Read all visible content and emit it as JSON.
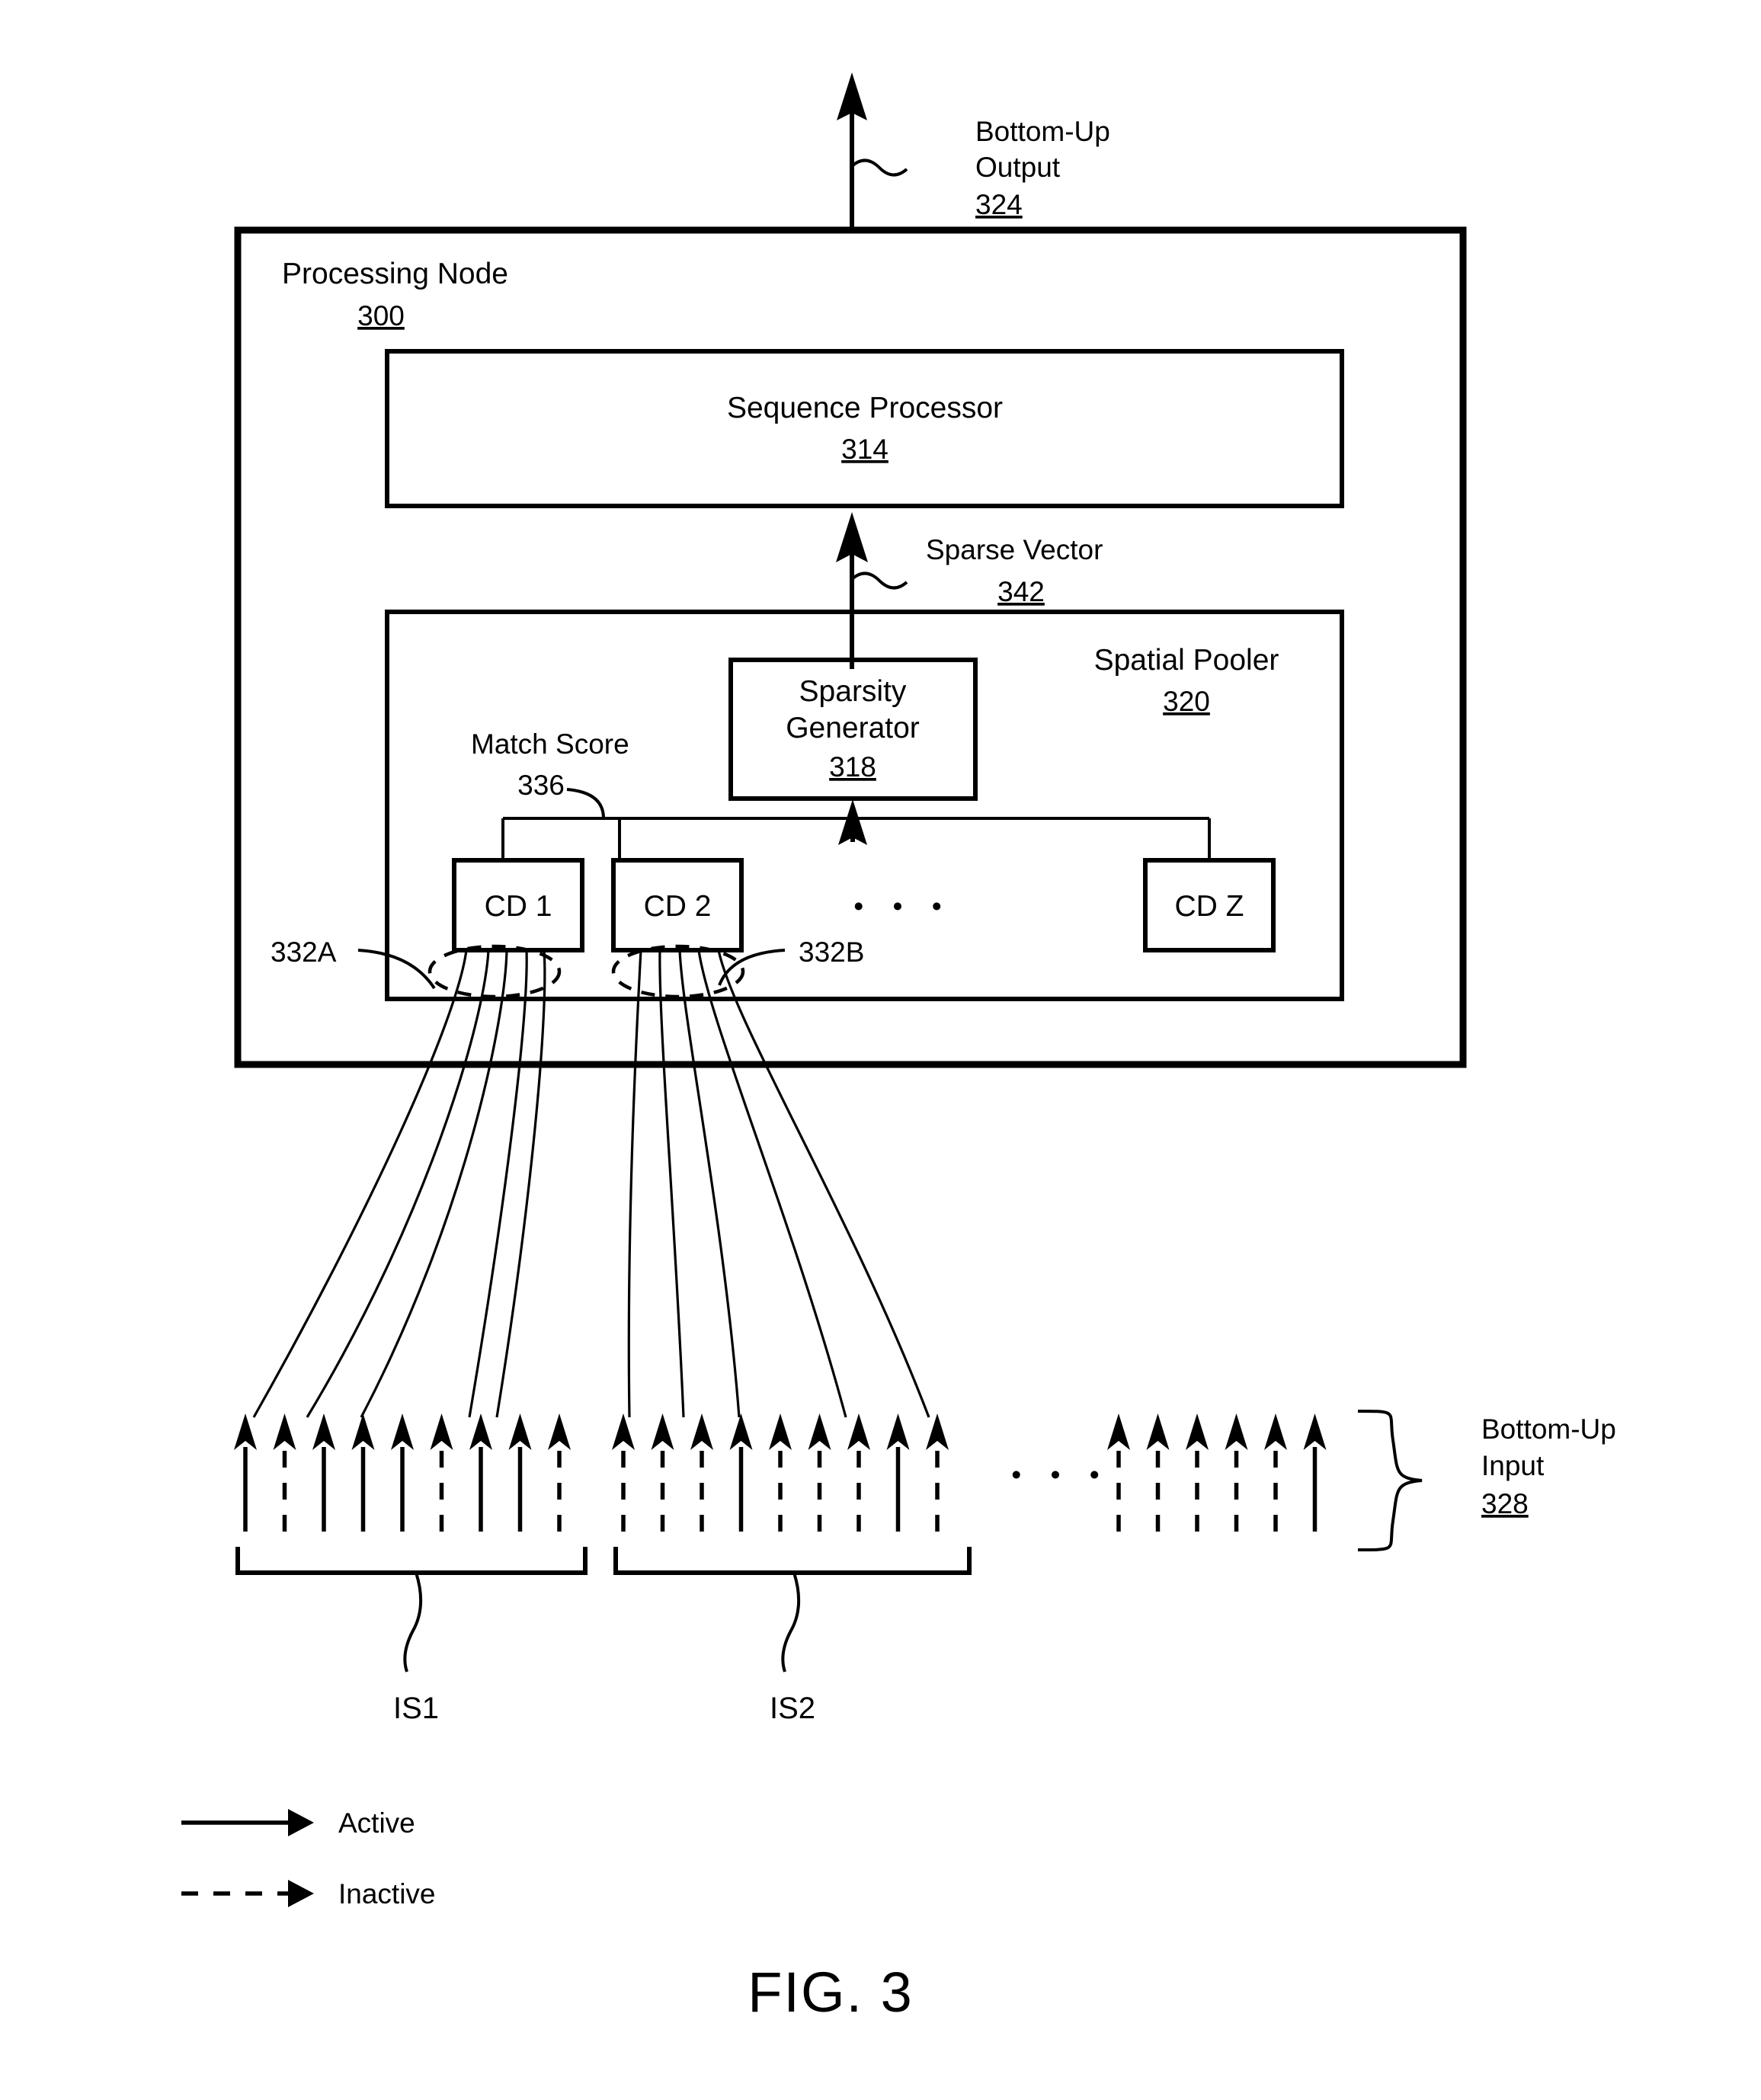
{
  "figure": {
    "caption": "FIG. 3"
  },
  "top": {
    "output_label_line1": "Bottom-Up",
    "output_label_line2": "Output",
    "output_ref": "324"
  },
  "processing_node": {
    "title": "Processing Node",
    "ref": "300"
  },
  "sequence_processor": {
    "title": "Sequence Processor",
    "ref": "314"
  },
  "sparse_vector": {
    "label": "Sparse Vector",
    "ref": "342"
  },
  "spatial_pooler": {
    "title": "Spatial Pooler",
    "ref": "320"
  },
  "sparsity_generator": {
    "title_line1": "Sparsity",
    "title_line2": "Generator",
    "ref": "318"
  },
  "match_score": {
    "label": "Match Score",
    "ref": "336"
  },
  "cells": [
    {
      "label": "CD 1"
    },
    {
      "label": "CD 2"
    },
    {
      "label": "CD Z"
    }
  ],
  "cell_ellipsis": "• • •",
  "dendrite_refs": {
    "left": "332A",
    "right": "332B"
  },
  "bottom_input": {
    "label_line1": "Bottom-Up",
    "label_line2": "Input",
    "ref": "328"
  },
  "input_groups": [
    {
      "name": "IS1",
      "states": [
        "active",
        "inactive",
        "active",
        "active",
        "active",
        "inactive",
        "active",
        "active",
        "inactive"
      ]
    },
    {
      "name": "IS2",
      "states": [
        "inactive",
        "inactive",
        "inactive",
        "active",
        "inactive",
        "inactive",
        "inactive",
        "active",
        "inactive"
      ]
    },
    {
      "name": "",
      "states": [
        "inactive",
        "inactive",
        "inactive",
        "inactive",
        "inactive",
        "active"
      ]
    }
  ],
  "input_ellipsis": "• • •",
  "legend": [
    {
      "style": "solid",
      "label": "Active"
    },
    {
      "style": "dashed",
      "label": "Inactive"
    }
  ],
  "colors": {
    "ink": "#000000",
    "paper": "#ffffff"
  }
}
